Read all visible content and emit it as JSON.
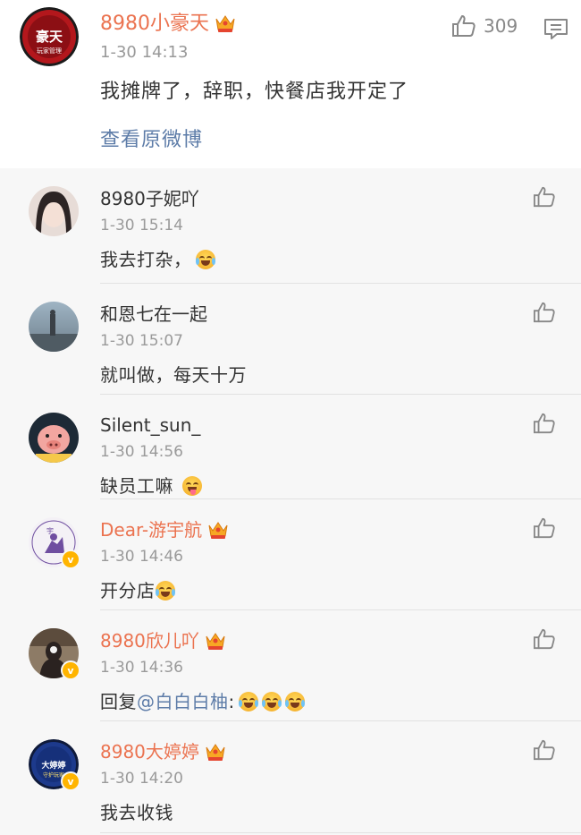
{
  "post": {
    "author": "8980小豪天",
    "time": "1-30 14:13",
    "text": "我摊牌了，辞职，快餐店我开定了",
    "view_original": "查看原微博",
    "like_count": "309",
    "avatar_text_top": "豪天",
    "avatar_text_bottom": "玩家管理"
  },
  "comments": [
    {
      "name": "8980子妮吖",
      "time": "1-30 15:14",
      "text": "我去打杂，",
      "vip": false,
      "verified": false
    },
    {
      "name": "和恩七在一起",
      "time": "1-30 15:07",
      "text": "就叫做，每天十万",
      "vip": false,
      "verified": false
    },
    {
      "name": "Silent_sun_",
      "time": "1-30 14:56",
      "text": "缺员工嘛",
      "vip": false,
      "verified": false
    },
    {
      "name": "Dear-游宇航",
      "time": "1-30 14:46",
      "text": "开分店",
      "vip": true,
      "verified": true
    },
    {
      "name": "8980欣儿吖",
      "time": "1-30 14:36",
      "text_prefix": "回复",
      "mention": "@白白白柚",
      "text_suffix": ":",
      "vip": true,
      "verified": true
    },
    {
      "name": "8980大婷婷",
      "time": "1-30 14:20",
      "text": "我去收钱",
      "vip": true,
      "verified": true,
      "avatar_text_top": "大婷婷",
      "avatar_text_bottom": "守护玩家"
    }
  ],
  "colors": {
    "vip_name": "#eb7350",
    "link": "#5d7ca8",
    "time": "#999999"
  },
  "icons": {
    "like": "thumbs-up-icon",
    "comment": "comment-icon",
    "crown": "vip-crown-icon",
    "verified": "verified-badge-icon",
    "laugh_cry": "laugh-cry-emoji",
    "yum": "yum-emoji"
  }
}
